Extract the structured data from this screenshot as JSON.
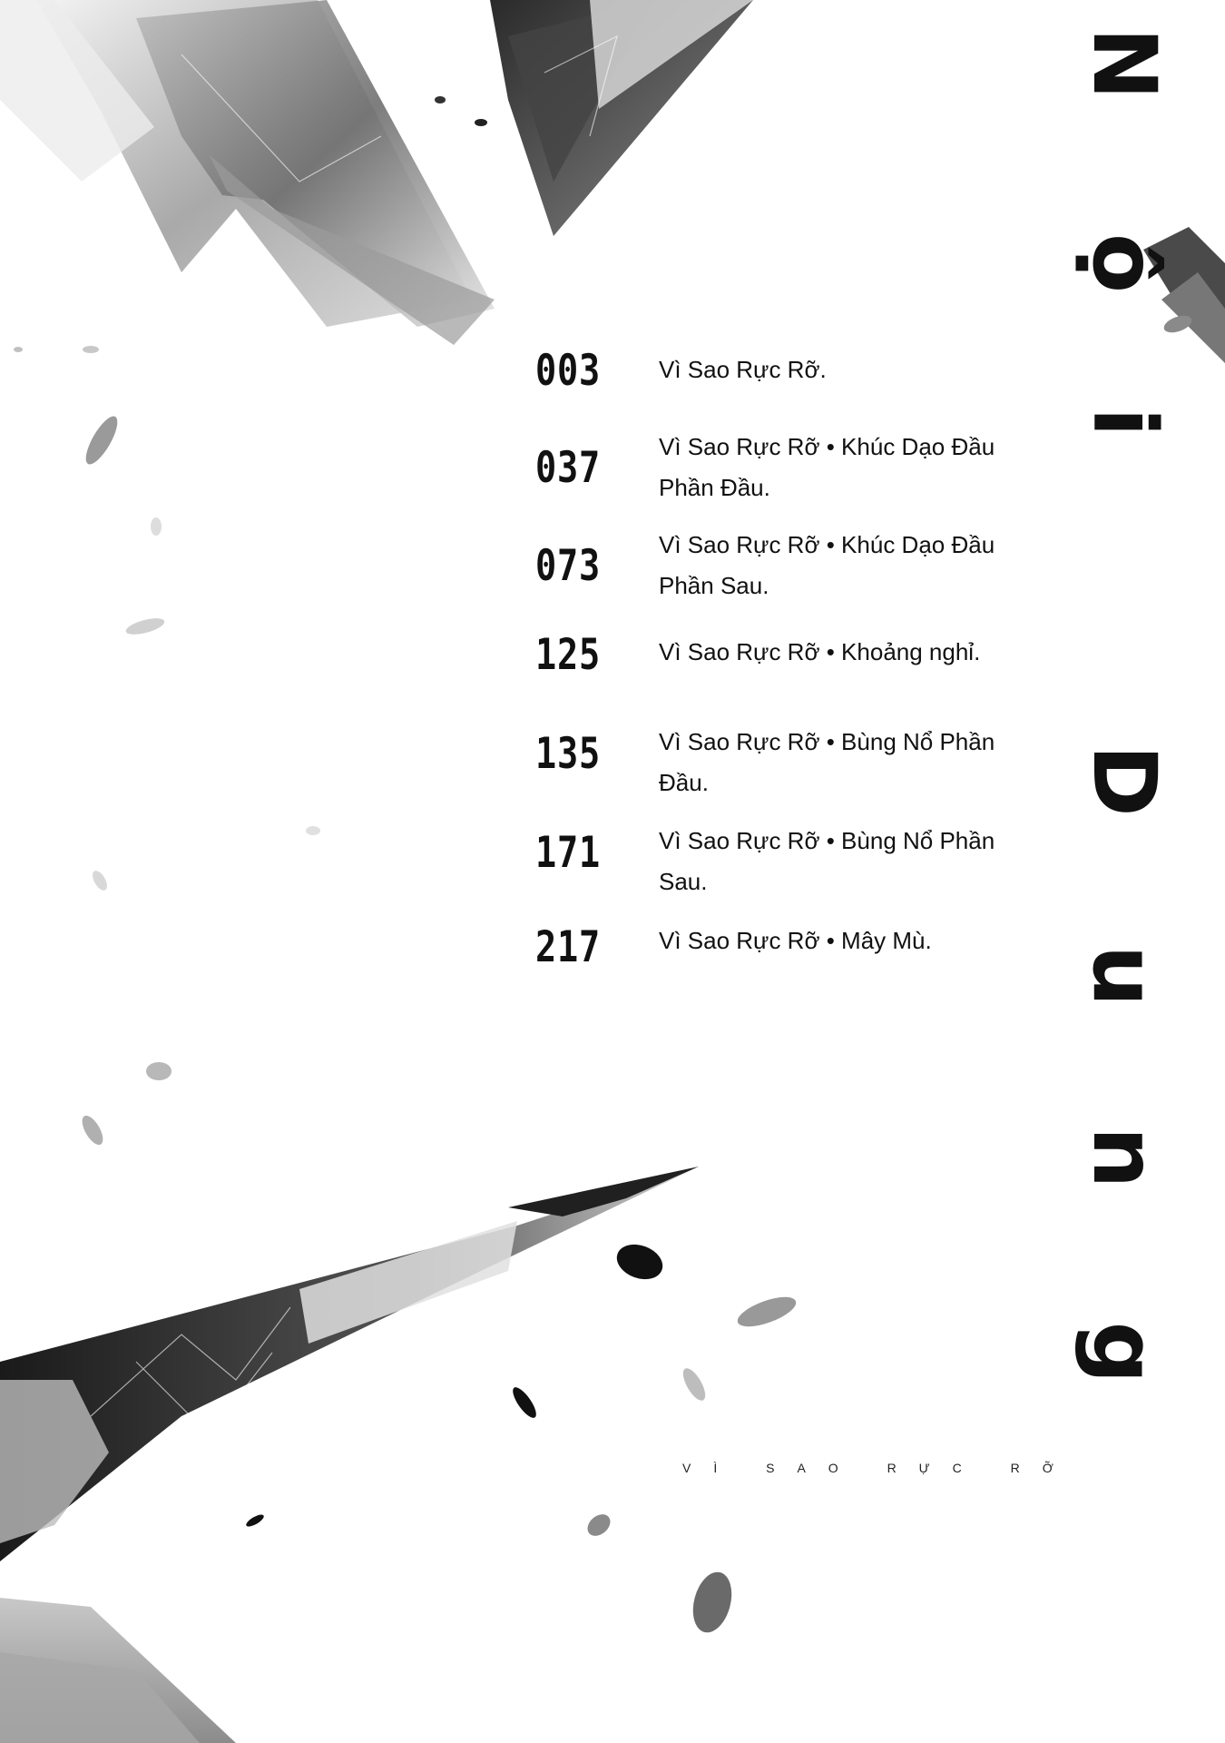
{
  "vertical_title": "Nội Dung",
  "toc": [
    {
      "page": "003",
      "title": "Vì Sao Rực Rỡ."
    },
    {
      "page": "037",
      "title": "Vì Sao Rực Rỡ • Khúc Dạo Đầu Phần Đầu."
    },
    {
      "page": "073",
      "title": "Vì Sao Rực Rỡ • Khúc Dạo Đầu Phần Sau."
    },
    {
      "page": "125",
      "title": "Vì Sao Rực Rỡ • Khoảng nghỉ."
    },
    {
      "page": "135",
      "title": "Vì Sao Rực Rỡ • Bùng Nổ Phần Đầu."
    },
    {
      "page": "171",
      "title": "Vì Sao Rực Rỡ • Bùng Nổ Phần Sau."
    },
    {
      "page": "217",
      "title": "Vì Sao Rực Rỡ • Mây Mù."
    }
  ],
  "series_caption": "VÌ SAO RỰC RỠ"
}
